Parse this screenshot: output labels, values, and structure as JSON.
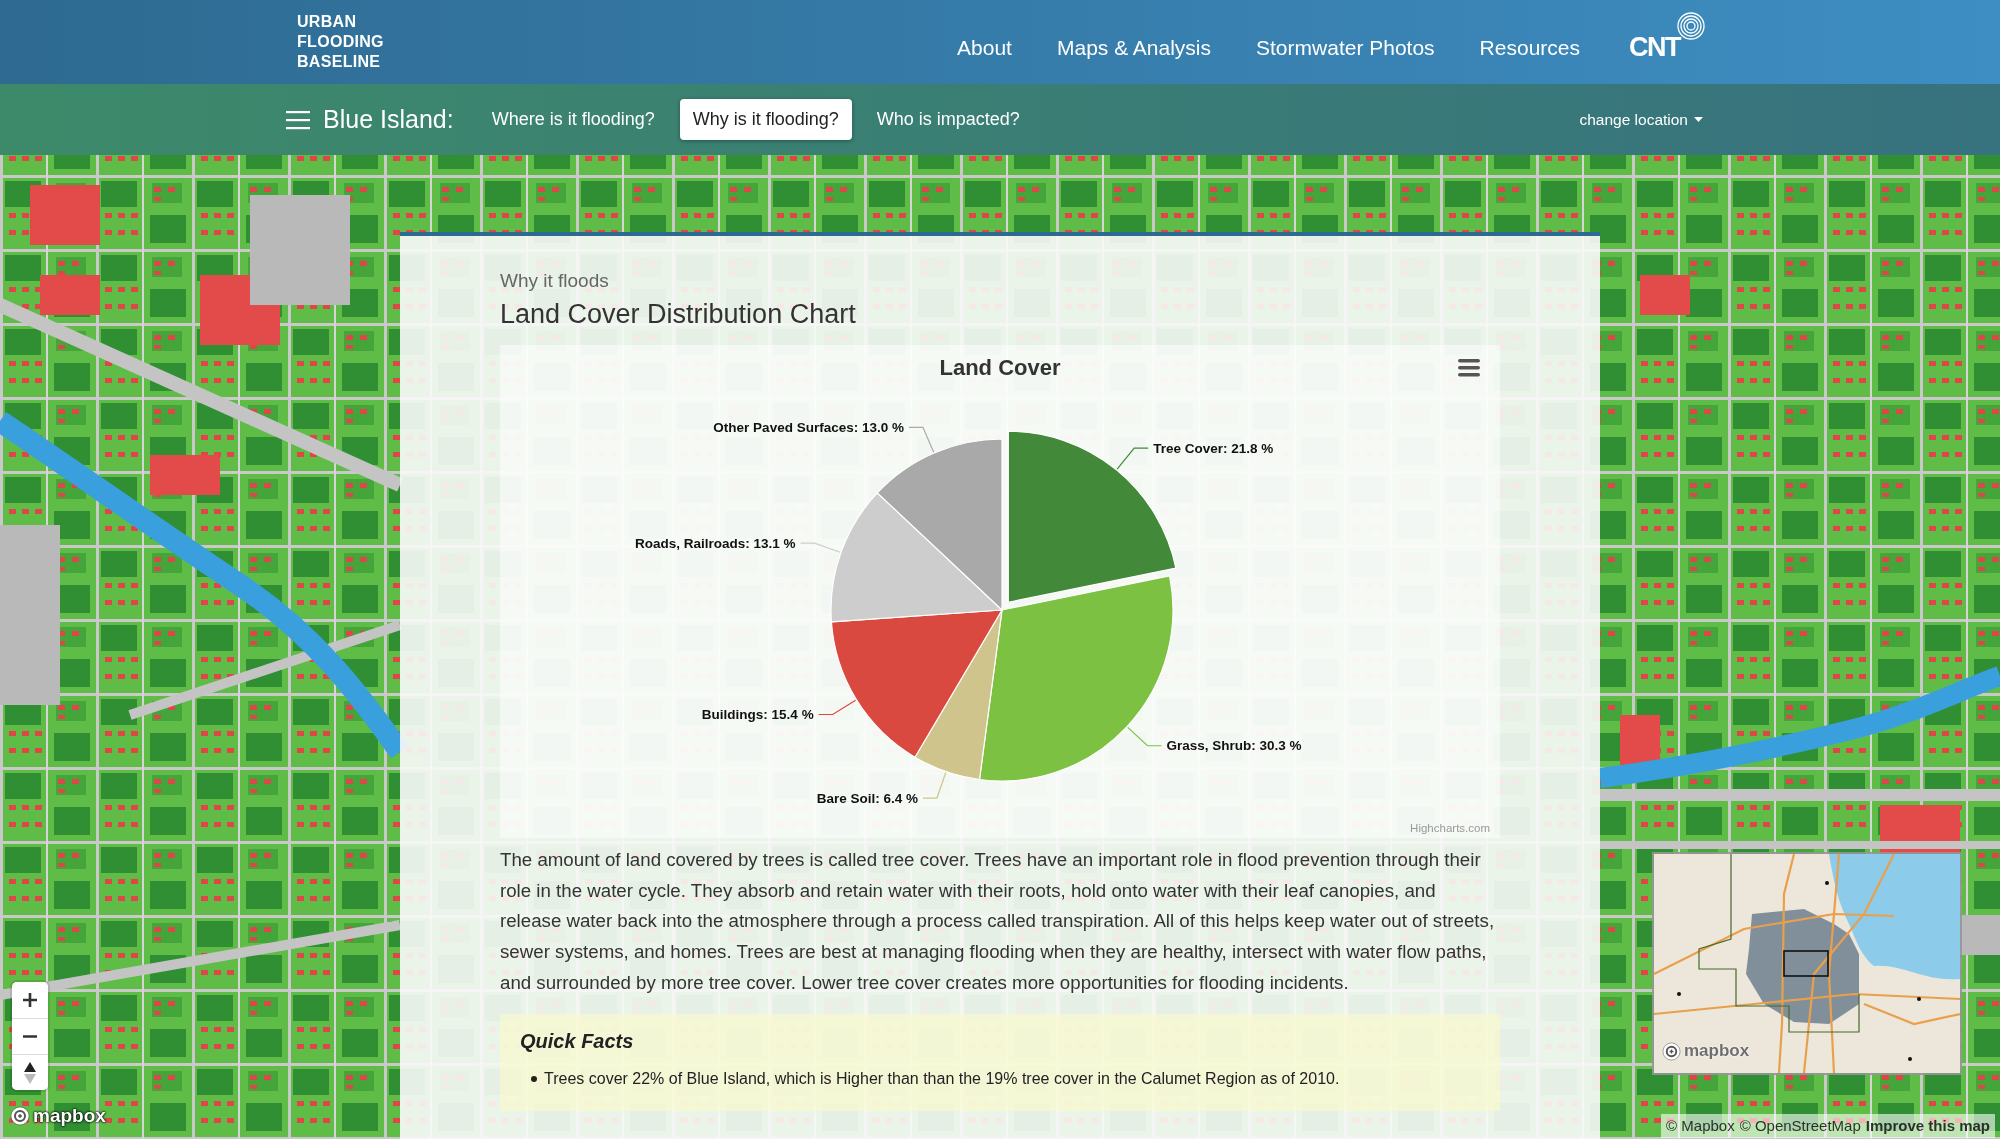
{
  "header": {
    "logo": "URBAN FLOODING BASELINE",
    "nav": [
      "About",
      "Maps & Analysis",
      "Stormwater Photos",
      "Resources"
    ],
    "brand": "CNT"
  },
  "subnav": {
    "location": "Blue Island:",
    "tabs": [
      {
        "label": "Where is it flooding?",
        "selected": false
      },
      {
        "label": "Why is it flooding?",
        "selected": true
      },
      {
        "label": "Who is impacted?",
        "selected": false
      }
    ],
    "change_location": "change location"
  },
  "panel": {
    "eyebrow": "Why it floods",
    "title": "Land Cover Distribution Chart",
    "chart_data": {
      "type": "pie",
      "title": "Land Cover",
      "values": [
        21.8,
        30.3,
        6.4,
        15.4,
        13.1,
        13.0
      ],
      "colors": [
        "#43893a",
        "#7cc142",
        "#cfc48c",
        "#d9493f",
        "#cdcdcd",
        "#a9a9a9"
      ],
      "value_labels": [
        "Tree Cover: 21.8 %",
        "Grass, Shrub: 30.3 %",
        "Bare Soil: 6.4 %",
        "Buildings: 15.4 %",
        "Roads, Railroads: 13.1 %",
        "Other Paved Surfaces: 13.0 %"
      ]
    },
    "slices": [
      {
        "sliced": true
      },
      {
        "sliced": false
      },
      {
        "sliced": false
      },
      {
        "sliced": false
      },
      {
        "sliced": false
      },
      {
        "sliced": false
      }
    ],
    "credit": "Highcharts.com",
    "paragraph": "The amount of land covered by trees is called tree cover. Trees have an important role in flood prevention through their role in the water cycle. They absorb and retain water with their roots, hold onto water with their leaf canopies, and release water back into the atmosphere through a process called transpiration. All of this helps keep water out of streets, sewer systems, and homes. Trees are best at managing flooding when they are healthy, intersect with water flow paths, and surrounded by more tree cover. Lower tree cover creates more opportunities for flooding incidents.",
    "quick_facts": {
      "title": "Quick Facts",
      "items": [
        "Trees cover 22% of Blue Island, which is Higher than than the 19% tree cover in the Calumet Region as of 2010."
      ]
    }
  },
  "map": {
    "logo": "mapbox",
    "minimap": {
      "logo": "mapbox"
    },
    "attribution": [
      {
        "label": "© Mapbox",
        "kind": "credit"
      },
      {
        "label": "© OpenStreetMap",
        "kind": "credit"
      },
      {
        "label": "Improve this map",
        "kind": "feedback"
      }
    ]
  }
}
